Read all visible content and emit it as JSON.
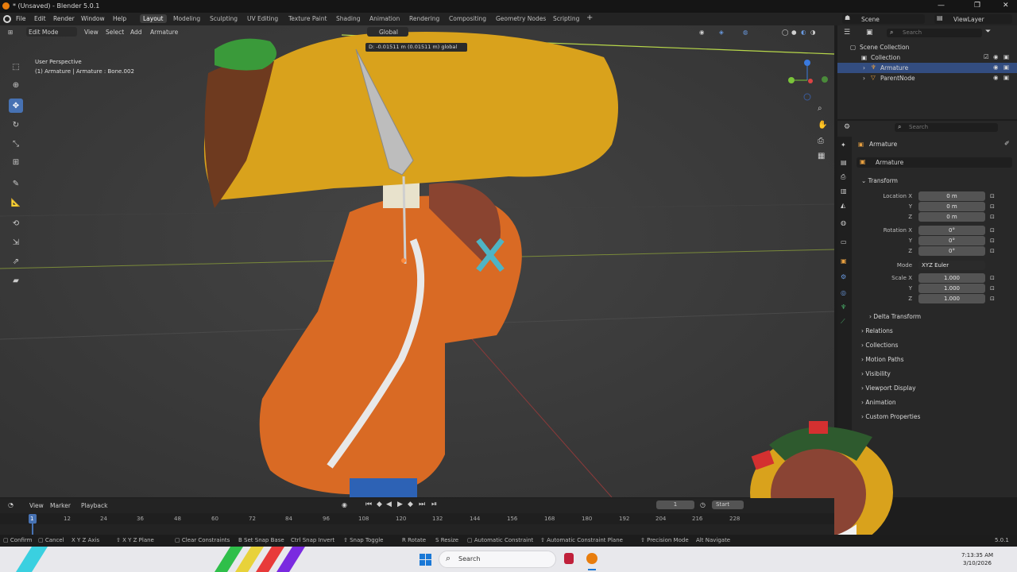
{
  "window": {
    "title": "* (Unsaved) - Blender 5.0.1",
    "min": "—",
    "max": "❐",
    "close": "✕"
  },
  "menu": [
    "File",
    "Edit",
    "Render",
    "Window",
    "Help"
  ],
  "workspaces": [
    "Layout",
    "Modeling",
    "Sculpting",
    "UV Editing",
    "Texture Paint",
    "Shading",
    "Animation",
    "Rendering",
    "Compositing",
    "Geometry Nodes",
    "Scripting"
  ],
  "workspace_add": "+",
  "scene": {
    "label": "Scene",
    "view_layer": "ViewLayer"
  },
  "viewport": {
    "mode": "Edit Mode",
    "view": "View",
    "select": "Select",
    "add": "Add",
    "armature": "Armature",
    "orientation": "Global",
    "info_line1": "User Perspective",
    "info_line2": "(1) Armature | Armature : Bone.002",
    "header_readout": "D: -0.01511 m (0.01511 m) global"
  },
  "outliner": {
    "search_placeholder": "Search",
    "scene_collection": "Scene Collection",
    "collection": "Collection",
    "items": [
      "Armature",
      "ParentNode"
    ]
  },
  "properties": {
    "search_placeholder": "Search",
    "object_name": "Armature",
    "data_name": "Armature",
    "transform_title": "Transform",
    "location": {
      "label": "Location X",
      "y": "Y",
      "z": "Z",
      "values": [
        "0 m",
        "0 m",
        "0 m"
      ]
    },
    "rotation": {
      "label": "Rotation X",
      "y": "Y",
      "z": "Z",
      "values": [
        "0°",
        "0°",
        "0°"
      ]
    },
    "mode": {
      "label": "Mode",
      "value": "XYZ Euler"
    },
    "scale": {
      "label": "Scale X",
      "y": "Y",
      "z": "Z",
      "values": [
        "1.000",
        "1.000",
        "1.000"
      ]
    },
    "sections": [
      "Delta Transform",
      "Relations",
      "Collections",
      "Motion Paths",
      "Visibility",
      "Viewport Display",
      "Animation",
      "Custom Properties"
    ]
  },
  "timeline": {
    "view": "View",
    "marker": "Marker",
    "playback": "Playback",
    "frame": "1",
    "start_label": "Start",
    "ticks": [
      "1",
      "12",
      "24",
      "36",
      "48",
      "60",
      "72",
      "84",
      "96",
      "108",
      "120",
      "132",
      "144",
      "156",
      "168",
      "180",
      "192",
      "204",
      "216",
      "228"
    ]
  },
  "status": [
    {
      "key": "",
      "text": "Confirm"
    },
    {
      "key": "",
      "text": "Cancel"
    },
    {
      "key": "X Y Z",
      "text": "Axis"
    },
    {
      "key": "X Y Z",
      "text": "Plane"
    },
    {
      "key": "",
      "text": "Clear Constraints"
    },
    {
      "key": "B",
      "text": "Set Snap Base"
    },
    {
      "key": "Ctrl",
      "text": "Snap Invert"
    },
    {
      "key": "",
      "text": "Snap Toggle"
    },
    {
      "key": "R",
      "text": "Rotate"
    },
    {
      "key": "S",
      "text": "Resize"
    },
    {
      "key": "",
      "text": "Automatic Constraint"
    },
    {
      "key": "",
      "text": "Automatic Constraint Plane"
    },
    {
      "key": "",
      "text": "Precision Mode"
    },
    {
      "key": "Alt",
      "text": "Navigate"
    }
  ],
  "version": "5.0.1",
  "taskbar": {
    "search": "Search",
    "time": "7:13:35 AM",
    "date": "3/10/2026"
  },
  "colors": {
    "accent": "#4772b3",
    "viewport_bg": "#3a3a3a",
    "taco": "#d9a21c",
    "hoodie": "#d96a24"
  }
}
